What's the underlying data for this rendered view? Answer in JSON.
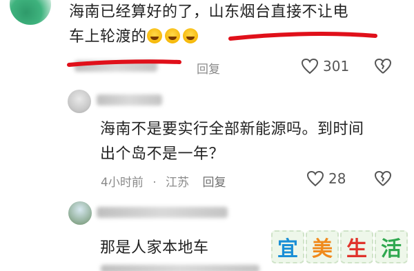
{
  "comments": [
    {
      "text_line1": "海南已经算好的了，山东烟台直接不让电",
      "text_line2": "车上轮渡的",
      "reply_label": "回复",
      "likes": "301"
    },
    {
      "text_line1": "海南不是要实行全部新能源吗。到时间",
      "text_line2": "出个岛不是一年？",
      "time": "4小时前",
      "dot": "·",
      "location": "江苏",
      "reply_label": "回复",
      "likes": "28"
    },
    {
      "text_line1": "那是人家本地车"
    }
  ],
  "icons": {
    "like": "heart-icon",
    "dislike": "broken-heart-icon"
  },
  "colors": {
    "annotation_red": "#e0101a",
    "watermark_yi": "#1a8fd6",
    "watermark_mei": "#f08a1c",
    "watermark_sheng": "#e0342c",
    "watermark_huo": "#2fa84f"
  },
  "watermark": [
    "宜",
    "美",
    "生",
    "活"
  ]
}
